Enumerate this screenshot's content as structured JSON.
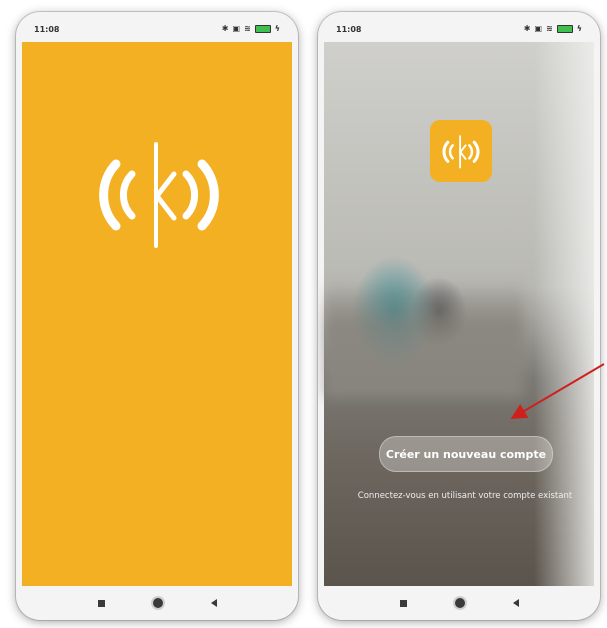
{
  "left_phone": {
    "status_time": "11:08",
    "screen_color": "#f3b023"
  },
  "right_phone": {
    "status_time": "11:08",
    "create_account_label": "Créer un nouveau compte",
    "login_text": "Connectez-vous en utilisant votre compte existant"
  },
  "annotation": {
    "arrow_color": "#d0201e"
  },
  "icons": {
    "logo": "kliot-logo-icon",
    "nav_recent": "square-icon",
    "nav_home": "circle-icon",
    "nav_back": "back-triangle-icon"
  }
}
